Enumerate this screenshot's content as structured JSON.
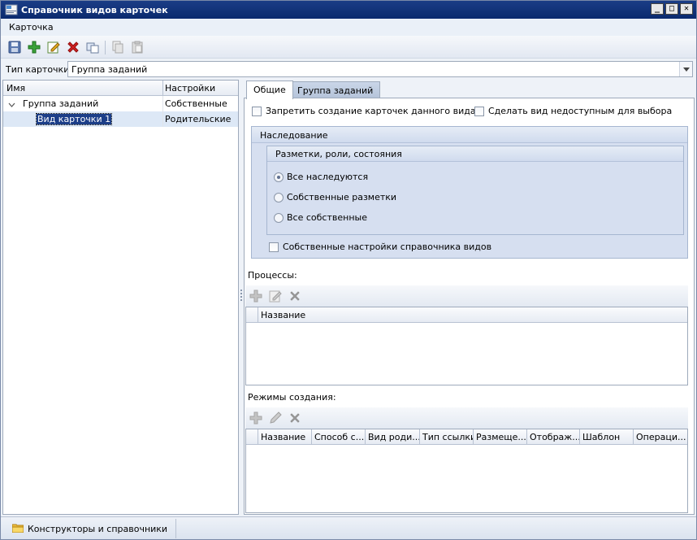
{
  "window": {
    "title": "Справочник видов карточек",
    "minimize_glyph": "_",
    "maximize_glyph": "□",
    "close_glyph": "✕"
  },
  "menu": {
    "items": [
      "Карточка"
    ]
  },
  "toolbar": {
    "icons": [
      "save-icon",
      "add-icon",
      "edit-icon",
      "delete-icon",
      "copy-icon",
      "clone-icon",
      "paste-icon"
    ]
  },
  "card_type": {
    "label": "Тип карточки:",
    "value": "Группа заданий"
  },
  "tree": {
    "columns": [
      "Имя",
      "Настройки"
    ],
    "rows": [
      {
        "name": "Группа заданий",
        "setting": "Собственные"
      },
      {
        "name": "Вид карточки 1",
        "setting": "Родительские"
      }
    ]
  },
  "tabs": [
    "Общие",
    "Группа заданий"
  ],
  "general": {
    "forbid_create_label": "Запретить создание карточек данного вида",
    "unavailable_label": "Сделать вид недоступным для выбора",
    "inheritance_title": "Наследование",
    "layouts_title": "Разметки, роли, состояния",
    "radio_options": [
      "Все наследуются",
      "Собственные разметки",
      "Все собственные"
    ],
    "radio_selected": 0,
    "own_settings_label": "Собственные настройки справочника видов"
  },
  "processes": {
    "label": "Процессы:",
    "columns": [
      "Название"
    ]
  },
  "creation_modes": {
    "label": "Режимы создания:",
    "columns": [
      "Название",
      "Способ с...",
      "Вид роди...",
      "Тип ссылки",
      "Размеще...",
      "Отображ...",
      "Шаблон",
      "Операци..."
    ]
  },
  "statusbar": {
    "item_label": "Конструкторы и справочники"
  },
  "colors": {
    "title_bar": "#0a2a6e",
    "selection": "#1c3e88",
    "group_bg": "#d6dff0"
  }
}
